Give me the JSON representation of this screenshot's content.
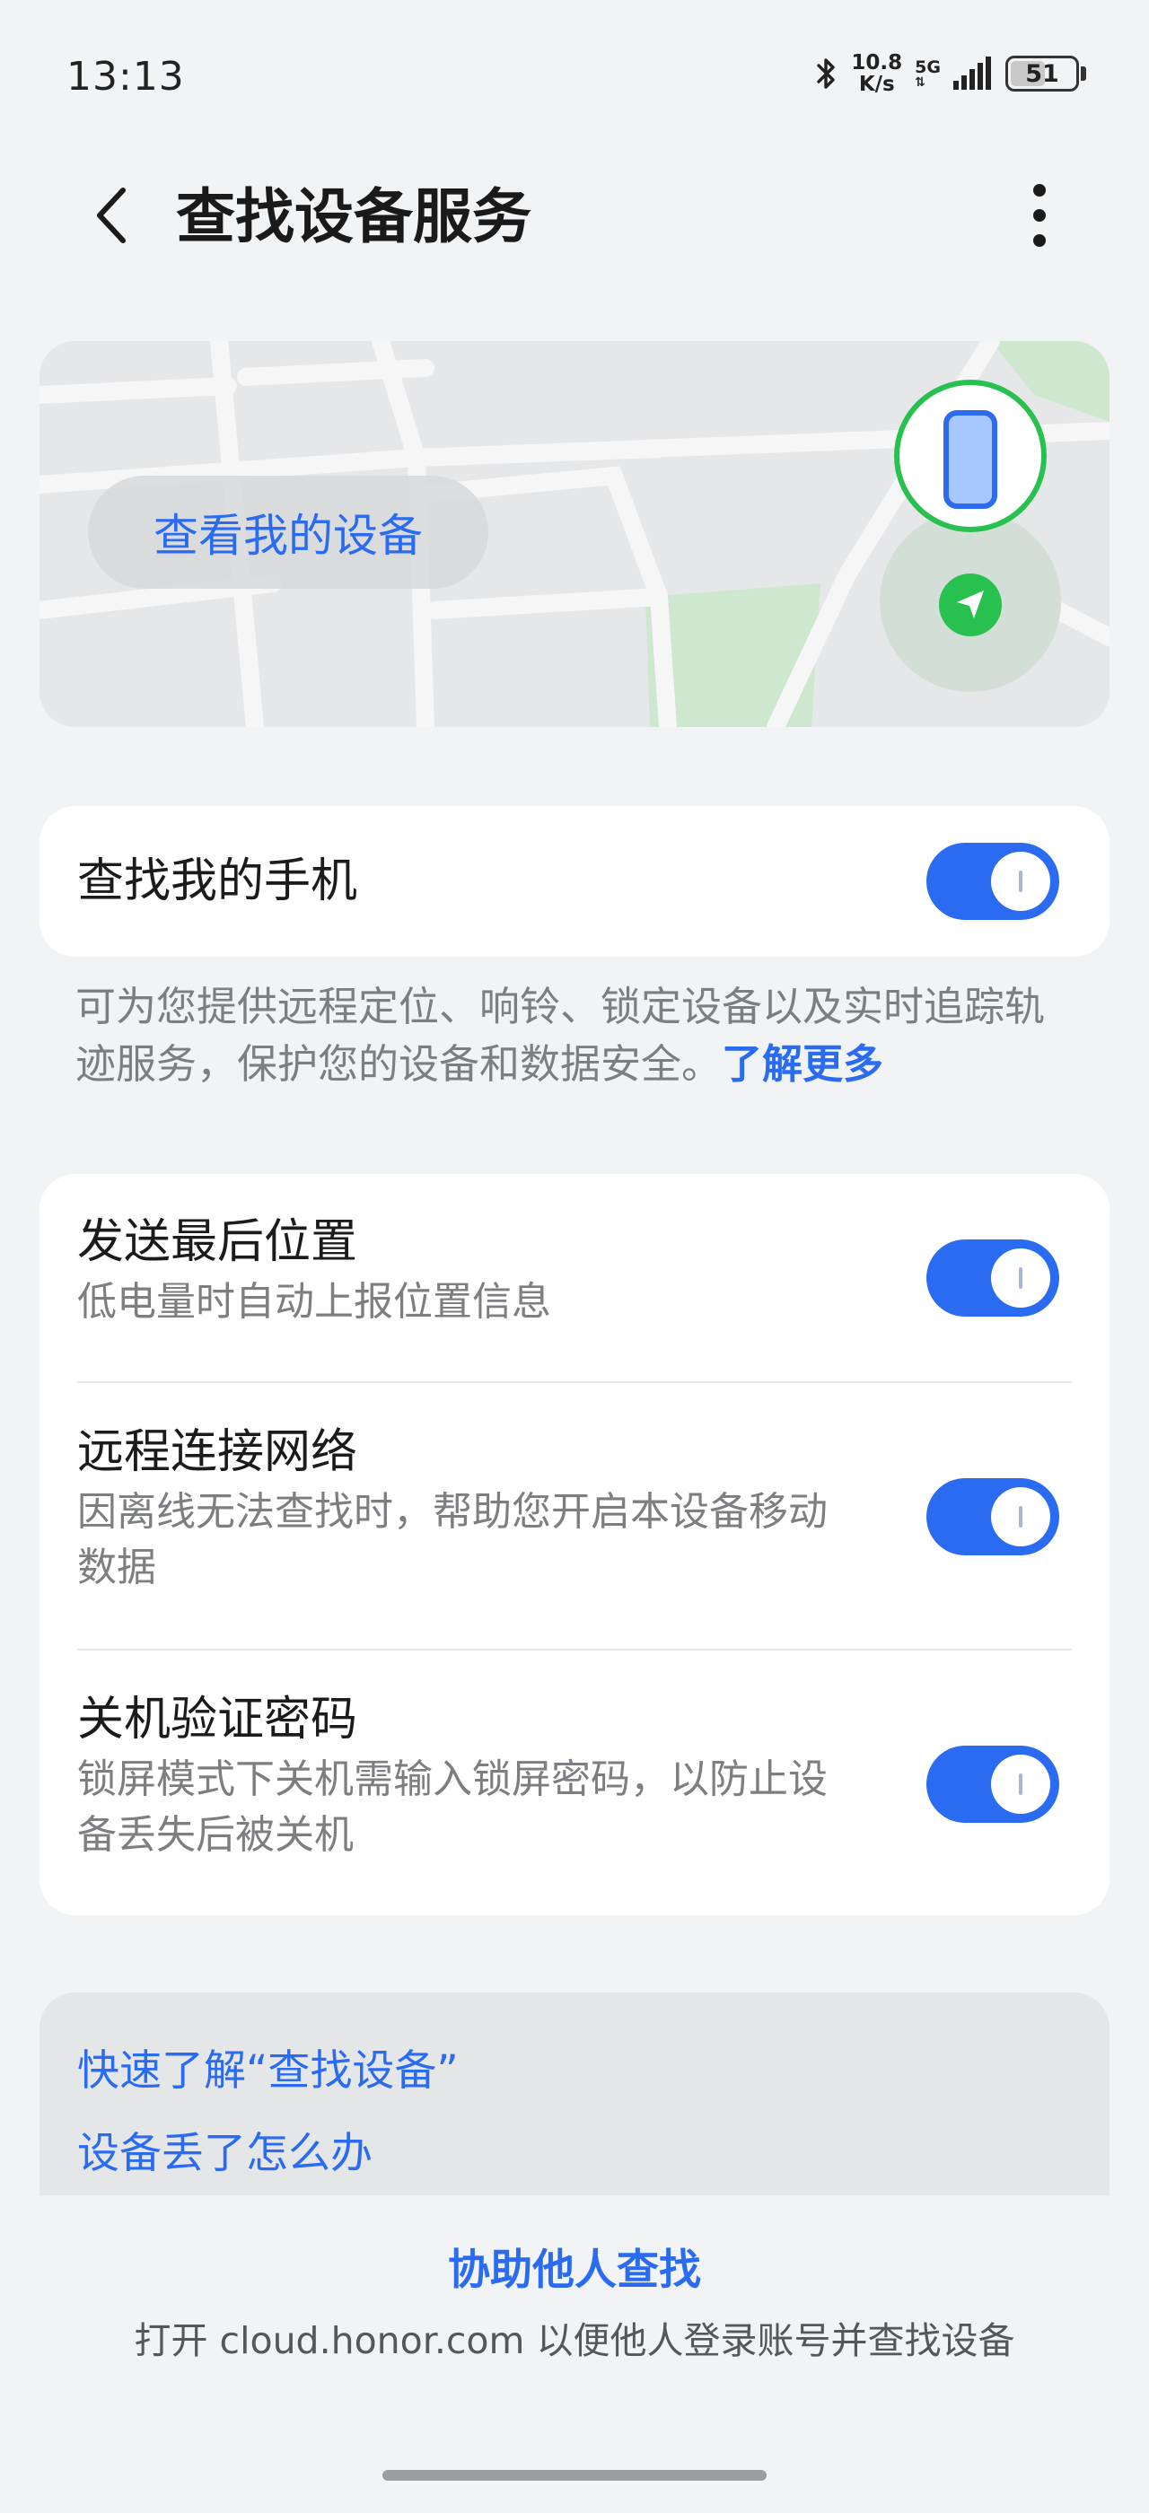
{
  "status_bar": {
    "time": "13:13",
    "net_speed_value": "10.8",
    "net_speed_unit": "K/s",
    "network_type": "5G",
    "battery_level": "51"
  },
  "header": {
    "title": "查找设备服务"
  },
  "map_card": {
    "button_label": "查看我的设备"
  },
  "find_phone": {
    "label": "查找我的手机",
    "enabled": true,
    "description": "可为您提供远程定位、响铃、锁定设备以及实时追踪轨迹服务，保护您的设备和数据安全。",
    "learn_more": "了解更多"
  },
  "settings": [
    {
      "title": "发送最后位置",
      "subtitle": "低电量时自动上报位置信息",
      "enabled": true
    },
    {
      "title": "远程连接网络",
      "subtitle": "因离线无法查找时，帮助您开启本设备移动数据",
      "enabled": true
    },
    {
      "title": "关机验证密码",
      "subtitle": "锁屏模式下关机需输入锁屏密码，以防止设备丢失后被关机",
      "enabled": true
    }
  ],
  "help_links": [
    "快速了解“查找设备”",
    "设备丢了怎么办"
  ],
  "assist": {
    "title": "协助他人查找",
    "description": "打开 cloud.honor.com 以便他人登录账号并查找设备"
  },
  "colors": {
    "accent": "#2a6bf2",
    "background": "#f1f3f5",
    "map_green": "#28c14f"
  }
}
